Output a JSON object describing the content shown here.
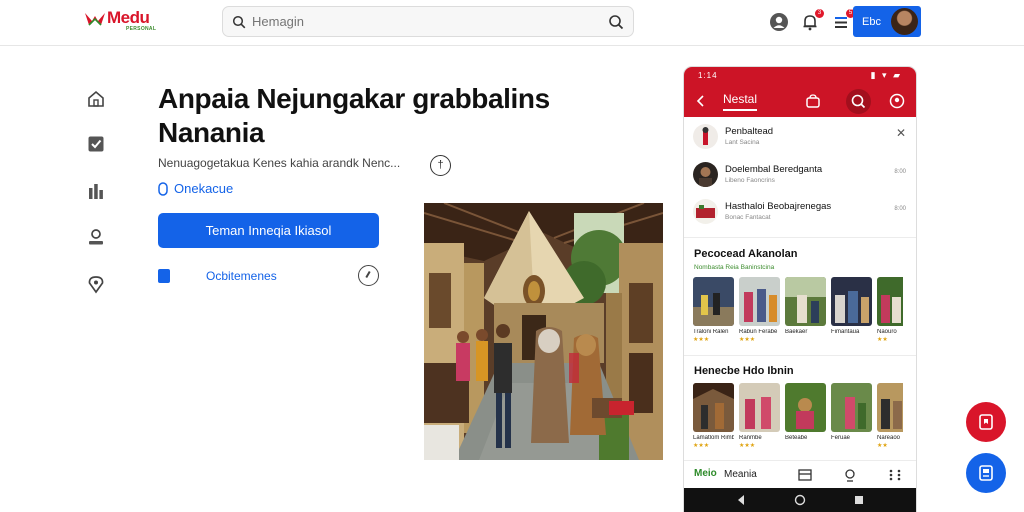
{
  "header": {
    "logo_text": "Medu",
    "logo_tagline": "PERSONAL",
    "search": {
      "value": "",
      "placeholder": "Hemagin"
    },
    "notification_count": "3",
    "message_count": "5",
    "profile_label": "Ebc"
  },
  "main": {
    "title": "Anpaia Nejungakar grabbalins Nanania",
    "subtitle": "Nenuagogetakua Kenes kahia arandk Nenc...",
    "link_label": "Onekacue",
    "primary_button": "Teman Inneqia Ikiasol",
    "option_label": "Ocbitemenes"
  },
  "phone": {
    "status_time": "1:14",
    "appbar_title": "Nestal",
    "rows": [
      {
        "title": "Penbaltead",
        "sub": "Lant Sacina",
        "meta": ""
      },
      {
        "title": "Doelembal Beredganta",
        "sub": "Libeno Faoncrins",
        "meta": "8:00"
      },
      {
        "title": "Hasthaloi Beobajrenegas",
        "sub": "Bonac Fantacat",
        "meta": "8:00"
      }
    ],
    "section1": {
      "title": "Pecocead Akanolan",
      "sub": "Nombasta Reia Baninstcina",
      "items": [
        {
          "caption": "Traloni Ralen",
          "stars": "★★★"
        },
        {
          "caption": "Rabun Ferabe",
          "stars": "★★★"
        },
        {
          "caption": "Baekaer",
          "stars": ""
        },
        {
          "caption": "Fimantaua",
          "stars": ""
        },
        {
          "caption": "Naouro",
          "stars": "★★"
        }
      ]
    },
    "section2": {
      "title": "Henecbe Hdo Ibnin",
      "items": [
        {
          "caption": "Lamatlom Rimbe",
          "stars": "★★★"
        },
        {
          "caption": "Ranmbe",
          "stars": "★★★"
        },
        {
          "caption": "Beteabe",
          "stars": ""
        },
        {
          "caption": "Feruae",
          "stars": ""
        },
        {
          "caption": "Nareaoo",
          "stars": "★★"
        }
      ]
    },
    "bottom_nav": {
      "brand": "Meio",
      "label": "Meania"
    }
  },
  "colors": {
    "brand_red": "#cc1426",
    "accent_blue": "#1463e8"
  }
}
